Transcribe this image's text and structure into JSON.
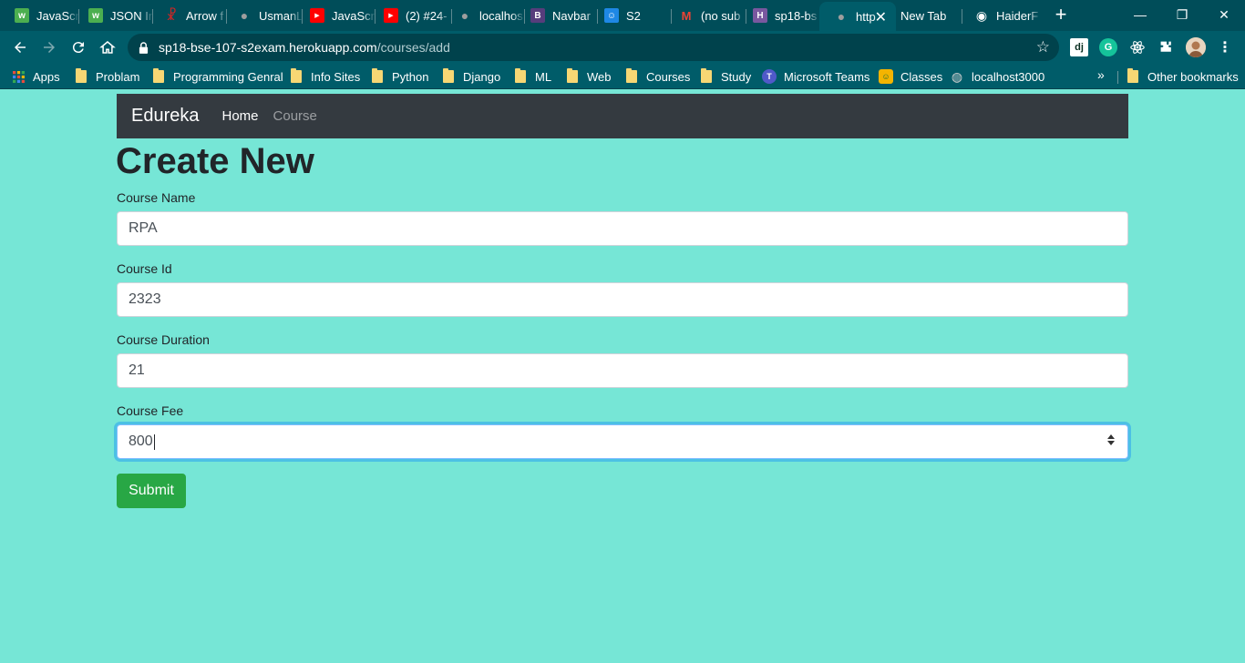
{
  "browser": {
    "tabs": [
      {
        "title": "JavaScr",
        "icon": "w3-icon",
        "color": "#4caf50",
        "glyph": "w"
      },
      {
        "title": "JSON In",
        "icon": "w3-icon",
        "color": "#4caf50",
        "glyph": "w"
      },
      {
        "title": "Arrow f",
        "icon": "figure-icon",
        "color": "#c62828",
        "glyph": "☧"
      },
      {
        "title": "UsmanL",
        "icon": "globe-icon",
        "color": "#607d8b",
        "glyph": "●"
      },
      {
        "title": "JavaScr",
        "icon": "youtube-icon",
        "color": "#ff0000",
        "glyph": "▶"
      },
      {
        "title": "(2) #24-",
        "icon": "youtube-icon",
        "color": "#ff0000",
        "glyph": "▶"
      },
      {
        "title": "localhos",
        "icon": "globe-icon",
        "color": "#607d8b",
        "glyph": "●"
      },
      {
        "title": "Navbar",
        "icon": "bootstrap-icon",
        "color": "#563d7c",
        "glyph": "B"
      },
      {
        "title": "S2",
        "icon": "classroom-icon",
        "color": "#1e88e5",
        "glyph": "☺"
      },
      {
        "title": "(no sub",
        "icon": "gmail-icon",
        "color": "#ea4335",
        "glyph": "M"
      },
      {
        "title": "sp18-bs",
        "icon": "heroku-icon",
        "color": "#79589f",
        "glyph": "H"
      },
      {
        "title": "http",
        "icon": "globe-icon",
        "color": "#607d8b",
        "glyph": "●"
      },
      {
        "title": "New Tab",
        "icon": "",
        "color": "",
        "glyph": ""
      },
      {
        "title": "HaiderF",
        "icon": "github-icon",
        "color": "#24292e",
        "glyph": "◉"
      }
    ],
    "close_glyph": "✕",
    "new_tab_glyph": "+",
    "window_controls": {
      "minimize": "—",
      "restore": "❐",
      "close": "✕"
    },
    "url_host": "sp18-bse-107-s2exam.herokuapp.com",
    "url_path": "/courses/add",
    "extensions": {
      "dj": "dj",
      "grammarly": "G"
    },
    "bookmarks": {
      "apps": "Apps",
      "items": [
        "Problam",
        "Programming Genral",
        "Info Sites",
        "Python",
        "Django",
        "ML",
        "Web",
        "Courses",
        "Study"
      ],
      "teams": "Microsoft Teams",
      "classes": "Classes",
      "localhost": "localhost3000",
      "more": "»",
      "other": "Other bookmarks"
    }
  },
  "navbar": {
    "brand": "Edureka",
    "links": [
      "Home",
      "Course"
    ]
  },
  "form": {
    "heading": "Create New",
    "fields": [
      {
        "label": "Course Name",
        "value": "RPA"
      },
      {
        "label": "Course Id",
        "value": "2323"
      },
      {
        "label": "Course Duration",
        "value": "21"
      },
      {
        "label": "Course Fee",
        "value": "800"
      }
    ],
    "submit_label": "Submit"
  },
  "colors": {
    "page_background": "#76e6d6",
    "navbar_background": "#343a40",
    "submit_background": "#28a745",
    "browser_frame": "#004d59"
  }
}
